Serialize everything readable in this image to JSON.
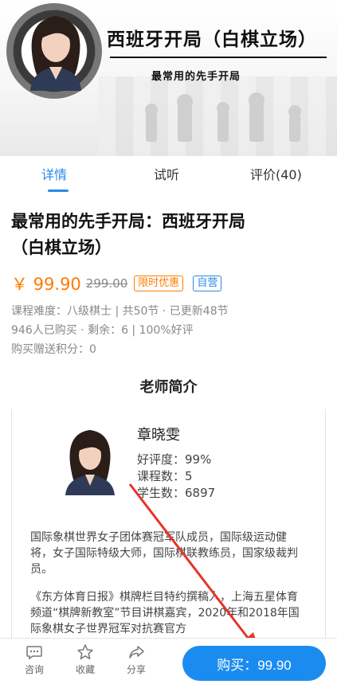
{
  "banner": {
    "title": "西班牙开局（白棋立场）",
    "subtitle": "最常用的先手开局"
  },
  "tabs": [
    {
      "label": "详情",
      "active": true
    },
    {
      "label": "试听",
      "active": false
    },
    {
      "label": "评价(40)",
      "active": false
    }
  ],
  "course": {
    "title_line1": "最常用的先手开局：西班牙开局",
    "title_line2": "（白棋立场）",
    "price": "￥ 99.90",
    "original_price": "299.00",
    "tag_promo": "限时优惠",
    "tag_self": "自营",
    "meta_line1": "课程难度：八级棋士 | 共50节 · 已更新48节",
    "meta_line2": "946人已购买 · 剩余：6 | 100%好评",
    "meta_line3": "购买赠送积分：0"
  },
  "teacher": {
    "heading": "老师简介",
    "name": "章晓雯",
    "rating": "好评度：99%",
    "courses": "课程数：5",
    "students": "学生数：6897",
    "bio1": "国际象棋世界女子团体赛冠军队成员，国际级运动健将，女子国际特级大师，国际棋联教练员，国家级裁判员。",
    "bio2": "《东方体育日报》棋牌栏目特约撰稿人，上海五星体育频道“棋牌新教室”节目讲棋嘉宾，2020年和2018年国际象棋女子世界冠军对抗赛官方"
  },
  "bottom_bar": {
    "consult_label": "咨询",
    "favorite_label": "收藏",
    "share_label": "分享",
    "buy_label": "购买：99.90"
  },
  "colors": {
    "accent": "#2a8ae6",
    "price": "#ff7a00",
    "buy_button": "#1a8cf0",
    "arrow": "#e8342a"
  },
  "icons": [
    "chat-bubble-icon",
    "star-icon",
    "share-icon"
  ]
}
